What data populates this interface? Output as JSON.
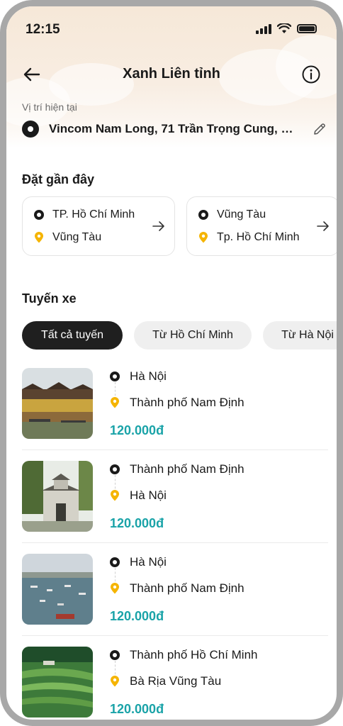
{
  "status_bar": {
    "time": "12:15"
  },
  "header": {
    "title": "Xanh Liên tỉnh"
  },
  "current_location": {
    "label": "Vị trí hiện tại",
    "address": "Vincom Nam Long, 71 Trần Trọng Cung, P..."
  },
  "recent": {
    "title": "Đặt gần đây",
    "items": [
      {
        "from": "TP. Hồ Chí Minh",
        "to": "Vũng Tàu"
      },
      {
        "from": "Vũng Tàu",
        "to": "Tp. Hồ Chí Minh"
      }
    ]
  },
  "routes_section": {
    "title": "Tuyến xe",
    "filters": [
      {
        "label": "Tất cả tuyến",
        "active": true
      },
      {
        "label": "Từ Hồ Chí Minh",
        "active": false
      },
      {
        "label": "Từ Hà Nội",
        "active": false
      }
    ],
    "routes": [
      {
        "from": "Hà Nội",
        "to": "Thành phố Nam Định",
        "price": "120.000đ",
        "image": "old-town-riverside-photo"
      },
      {
        "from": "Thành phố Nam Định",
        "to": "Hà Nội",
        "price": "120.000đ",
        "image": "temple-gate-photo"
      },
      {
        "from": "Hà Nội",
        "to": "Thành phố Nam Định",
        "price": "120.000đ",
        "image": "fishing-boats-bay-photo"
      },
      {
        "from": "Thành phố Hồ Chí Minh",
        "to": "Bà Rịa Vũng Tàu",
        "price": "120.000đ",
        "image": "green-rice-terraces-photo"
      }
    ]
  },
  "colors": {
    "price": "#1aa3a8",
    "pin": "#f5b400",
    "chip_active": "#1f1f1f"
  }
}
